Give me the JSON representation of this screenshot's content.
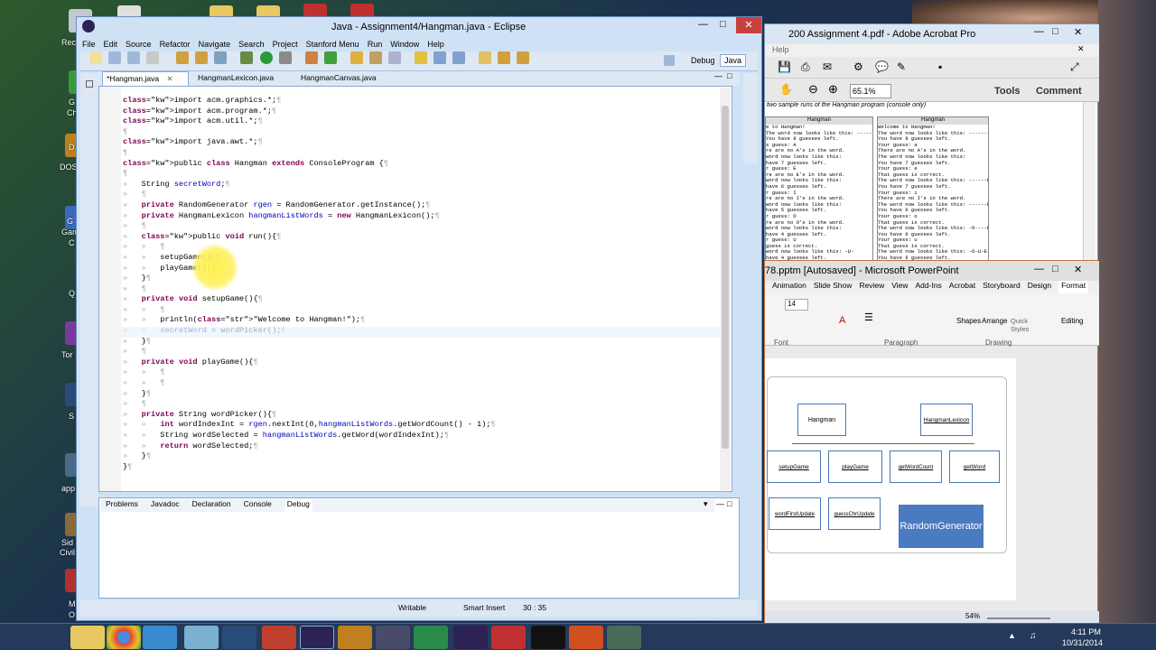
{
  "eclipse": {
    "title": "Java - Assignment4/Hangman.java - Eclipse",
    "menu": [
      "File",
      "Edit",
      "Source",
      "Refactor",
      "Navigate",
      "Search",
      "Project",
      "Stanford Menu",
      "Run",
      "Window",
      "Help"
    ],
    "perspectives": [
      "Debug",
      "Java"
    ],
    "tabs": [
      "*Hangman.java",
      "HangmanLexicon.java",
      "HangmanCanvas.java"
    ],
    "code": [
      "import acm.graphics.*;¶",
      "import acm.program.*;¶",
      "import acm.util.*;¶",
      "¶",
      "import java.awt.*;¶",
      "¶",
      "public class Hangman extends ConsoleProgram {¶",
      "¶",
      "»   String secretWord;¶",
      "»   ¶",
      "»   private RandomGenerator rgen = RandomGenerator.getInstance();¶",
      "»   private HangmanLexicon hangmanListWords = new HangmanLexicon();¶",
      "»   ¶",
      "»   public void run(){¶",
      "»   »   ¶",
      "»   »   setupGame();¶",
      "»   »   playGame();¶",
      "»   }¶",
      "»   ¶",
      "»   private void setupGame(){¶",
      "»   »   ¶",
      "»   »   println(\"Welcome to Hangman!\");¶",
      "»   »   secretWord = wordPicker();¶",
      "»   }¶",
      "»   ¶",
      "»   private void playGame(){¶",
      "»   »   ¶",
      "»   »   ¶",
      "»   }¶",
      "»   ¶",
      "»   private String wordPicker(){¶",
      "»   »   int wordIndexInt = rgen.nextInt(0,hangmanListWords.getWordCount() - 1);¶",
      "»   »   String wordSelected = hangmanListWords.getWord(wordIndexInt);¶",
      "»   »   return wordSelected;¶",
      "»   }¶",
      "}¶"
    ],
    "bottom_tabs": [
      "Problems",
      "Javadoc",
      "Declaration",
      "Console",
      "Debug"
    ],
    "status": {
      "writable": "Writable",
      "insert": "Smart Insert",
      "position": "30 : 35"
    }
  },
  "acrobat": {
    "title": "200 Assignment 4.pdf - Adobe Acrobat Pro",
    "menu_help": "Help",
    "zoom": "65.1%",
    "tools": "Tools",
    "comment": "Comment",
    "doc_caption": "two sample runs of the Hangman program (console only)",
    "panel_title": "Hangman",
    "run_left": [
      "e to Hangman!",
      "The word now looks like this: -----",
      "You have 8 guesses left.",
      "s guess: A",
      "re are no A's in the word.",
      "word now looks like this:",
      "have 7 guesses left.",
      "r guess: E",
      "re are no E's in the word.",
      "word now looks like this:",
      "have 6 guesses left.",
      "r guess: I",
      "re are no I's in the word.",
      "word now looks like this:",
      "have 5 guesses left.",
      "r guess: O",
      "re are no O's in the word.",
      "word now looks like this:",
      "have 4 guesses left.",
      "r guess: U",
      "guess is correct.",
      "word now looks like this: -U-",
      "have 4 guesses left."
    ],
    "run_right": [
      "Welcome to Hangman!",
      "The word now looks like this: --------",
      "You have 8 guesses left.",
      "Your guess: a",
      "There are no A's in the word.",
      "The word now looks like this:",
      "You have 7 guesses left.",
      "Your guess: e",
      "That guess is correct.",
      "The word now looks like this: ------E-",
      "You have 7 guesses left.",
      "Your guess: i",
      "There are no I's in the word.",
      "The word now looks like this: ------E-",
      "You have 6 guesses left.",
      "Your guess: o",
      "That guess is correct.",
      "The word now looks like this: -O----E-",
      "You have 6 guesses left.",
      "Your guess: u",
      "That guess is correct.",
      "The word now looks like this: -O-U-E-",
      "You have 6 guesses left."
    ]
  },
  "ppt": {
    "title": "78.pptm [Autosaved] - Microsoft PowerPoint",
    "tabs": [
      "Animation",
      "Slide Show",
      "Review",
      "View",
      "Add-Ins",
      "Acrobat",
      "Storyboard",
      "Design",
      "Format"
    ],
    "font_size": "14",
    "groups": [
      "Font",
      "Paragraph",
      "Drawing"
    ],
    "shapes_btn": "Shapes",
    "arrange_btn": "Arrange",
    "quick_styles": "Quick Styles",
    "editing": "Editing",
    "boxes": [
      "Hangman",
      "HangmanLexicon",
      "setupGame",
      "playGame",
      "getWordCount",
      "getWord",
      "wordFirstUpdate",
      "guessChrUpdate",
      "RandomGenerator"
    ],
    "zoom": "54%"
  },
  "desktop": {
    "labels": [
      "Rec",
      "G",
      "Ch",
      "D",
      "DOS",
      "G",
      "Gam",
      "C",
      "Q",
      "Tor",
      "S",
      "app",
      "Sid",
      "Civil",
      "M",
      "O"
    ]
  },
  "taskbar": {
    "time": "4:11 PM",
    "date": "10/31/2014"
  }
}
